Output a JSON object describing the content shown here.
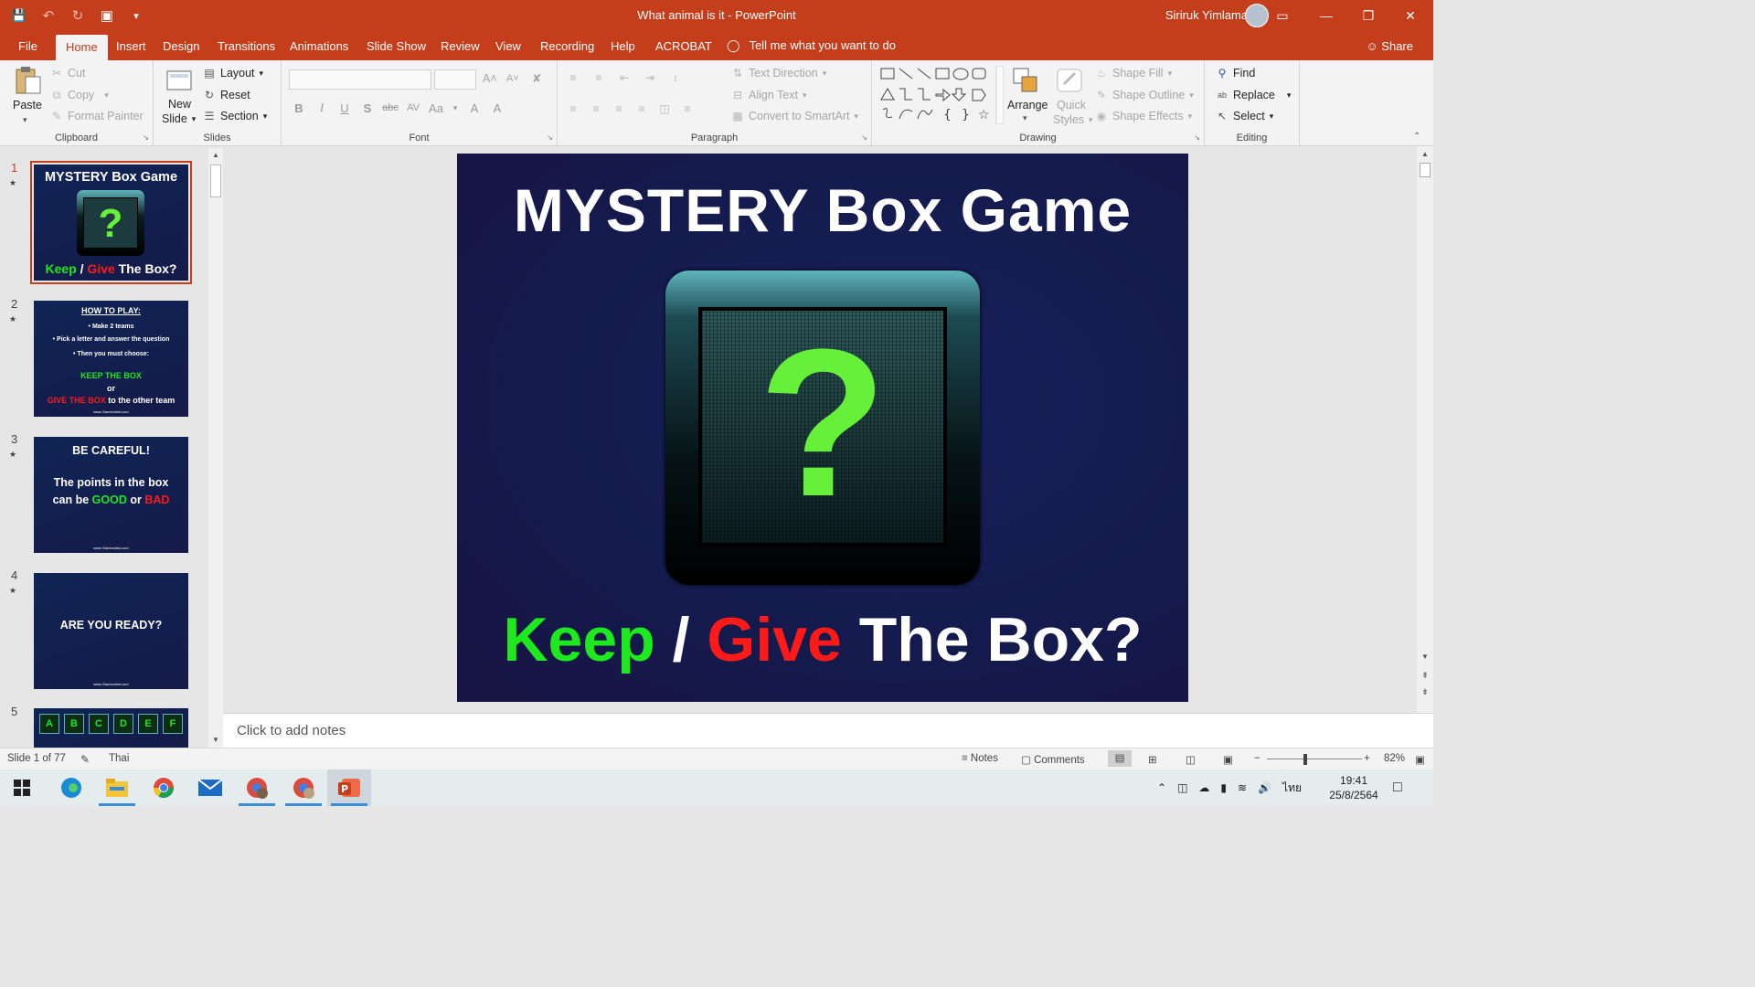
{
  "window": {
    "title": "What animal is it  -  PowerPoint",
    "user_name": "Siriruk Yimlamai",
    "controls": {
      "minimize": "—",
      "restore": "❐",
      "close": "✕",
      "ribbon_display": "▭"
    }
  },
  "quick_access": {
    "save": "💾",
    "undo": "↶",
    "redo": "↻",
    "present": "▣",
    "customize": "▾"
  },
  "tabs": [
    "File",
    "Home",
    "Insert",
    "Design",
    "Transitions",
    "Animations",
    "Slide Show",
    "Review",
    "View",
    "Recording",
    "Help",
    "ACROBAT"
  ],
  "active_tab": "Home",
  "tell_me": "Tell me what you want to do",
  "share": "Share",
  "ribbon": {
    "clipboard": {
      "label": "Clipboard",
      "paste": "Paste",
      "cut": "Cut",
      "copy": "Copy",
      "format_painter": "Format Painter"
    },
    "slides": {
      "label": "Slides",
      "new_slide_1": "New",
      "new_slide_2": "Slide",
      "layout": "Layout",
      "reset": "Reset",
      "section": "Section"
    },
    "font": {
      "label": "Font",
      "buttons": [
        "B",
        "I",
        "U",
        "S",
        "abc",
        "AV",
        "Aa",
        "A",
        "A"
      ]
    },
    "paragraph": {
      "label": "Paragraph",
      "text_direction": "Text Direction",
      "align_text": "Align Text",
      "convert_smartart": "Convert to SmartArt"
    },
    "drawing": {
      "label": "Drawing",
      "arrange": "Arrange",
      "quick_styles_1": "Quick",
      "quick_styles_2": "Styles",
      "shape_fill": "Shape Fill",
      "shape_outline": "Shape Outline",
      "shape_effects": "Shape Effects"
    },
    "editing": {
      "label": "Editing",
      "find": "Find",
      "replace": "Replace",
      "select": "Select"
    }
  },
  "thumbnails": [
    {
      "num": "1",
      "title": "MYSTERY Box Game",
      "keep": "Keep",
      "slash": " / ",
      "give": "Give",
      "rest": " The Box?",
      "qmark": "?"
    },
    {
      "num": "2",
      "heading": "HOW TO PLAY:",
      "bullets": [
        "Make 2 teams",
        "Pick a letter and answer the question",
        "Then you must choose:"
      ],
      "keep": "KEEP THE BOX",
      "or": "or",
      "give": "GIVE THE BOX",
      "give_rest": " to the other team",
      "footer": "www.Games4esl.com"
    },
    {
      "num": "3",
      "line1": "BE CAREFUL!",
      "line2": "The points in the box",
      "line3a": "can be ",
      "good": "GOOD",
      "or": " or ",
      "bad": "BAD",
      "footer": "www.Games4esl.com"
    },
    {
      "num": "4",
      "text": "ARE YOU READY?",
      "footer": "www.Games4esl.com"
    },
    {
      "num": "5",
      "letters": [
        "A",
        "B",
        "C",
        "D",
        "E",
        "F"
      ]
    }
  ],
  "slide": {
    "title": "MYSTERY Box Game",
    "question_mark": "?",
    "keep": "Keep",
    "slash": " / ",
    "give": "Give",
    "rest": " The Box?"
  },
  "notes_placeholder": "Click to add notes",
  "status": {
    "slide_info": "Slide 1 of 77",
    "language": "Thai",
    "notes": "Notes",
    "comments": "Comments",
    "zoom": "82%"
  },
  "taskbar": {
    "apps": [
      "start-icon",
      "edge-icon",
      "file-explorer-icon",
      "chrome-icon",
      "mail-icon",
      "chrome-profile-icon",
      "chrome-profile-2-icon",
      "powerpoint-icon"
    ],
    "lang": "ไทย",
    "time": "19:41",
    "date": "25/8/2564"
  },
  "colors": {
    "accent": "#c43e1c",
    "slide_bg": "#141a4c",
    "keep": "#1ee81e",
    "give": "#ff1a1a",
    "qmark": "#66f03a"
  }
}
